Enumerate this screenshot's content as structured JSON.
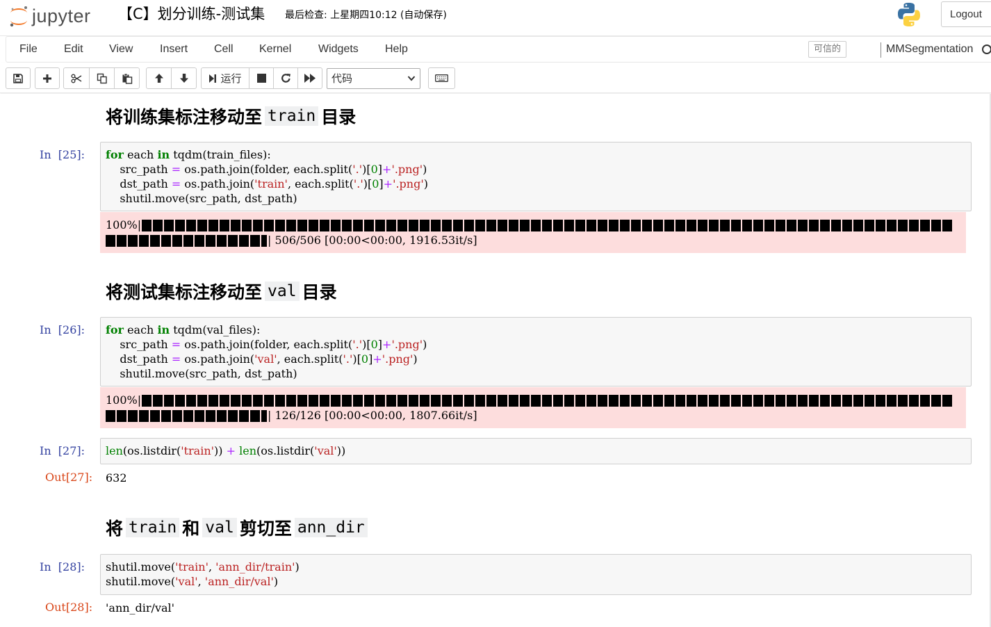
{
  "header": {
    "logo_text": "jupyter",
    "notebook_title": "【C】划分训练-测试集",
    "checkpoint": "最后检查: 上星期四10:12  (自动保存)",
    "logout_label": "Logout"
  },
  "menubar": {
    "items": [
      "File",
      "Edit",
      "View",
      "Insert",
      "Cell",
      "Kernel",
      "Widgets",
      "Help"
    ],
    "trusted_label": "可信的",
    "kernel_name": "MMSegmentation"
  },
  "toolbar": {
    "run_label": "运行",
    "cell_type": "代码"
  },
  "cells": {
    "h1": {
      "before": "将训练集标注移动至",
      "code": "train",
      "after": "目录"
    },
    "c25": {
      "prompt": "In  [25]:",
      "progress_pct": "100%|",
      "progress_tail": "| 506/506 [00:00<00:00, 1916.53it/s]"
    },
    "h2": {
      "before": "将测试集标注移动至",
      "code": "val",
      "after": "目录"
    },
    "c26": {
      "prompt": "In  [26]:",
      "progress_pct": "100%|",
      "progress_tail": "| 126/126 [00:00<00:00, 1807.66it/s]"
    },
    "c27": {
      "prompt": "In  [27]:",
      "out_prompt": "Out[27]:",
      "output": "632"
    },
    "h3": {
      "w1": "将",
      "c1": "train",
      "w2": "和",
      "c2": "val",
      "w3": "剪切至",
      "c3": "ann_dir"
    },
    "c28": {
      "prompt": "In  [28]:",
      "out_prompt": "Out[28]:",
      "output": "'ann_dir/val'"
    }
  },
  "colors": {
    "prompt_in": "#303f9f",
    "prompt_out": "#d84315",
    "stderr_bg": "#fddddd",
    "input_bg": "#f7f7f7",
    "keyword": "#008000",
    "string": "#ba2121"
  }
}
